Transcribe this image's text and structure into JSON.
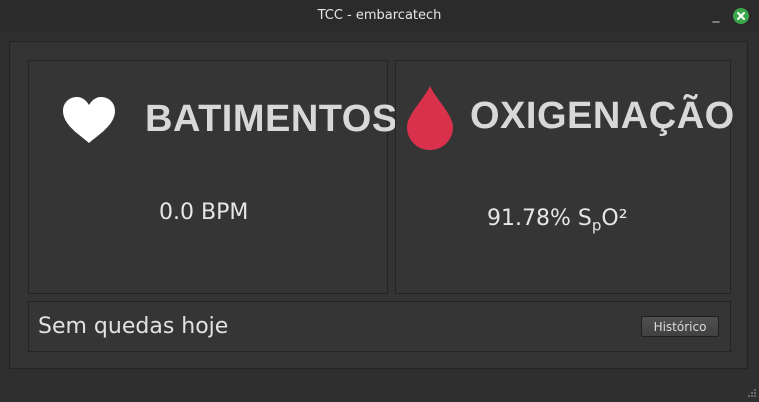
{
  "window": {
    "title": "TCC - embarcatech",
    "minimize_glyph": "_"
  },
  "heart": {
    "icon": "heart-icon",
    "heading": "BATIMENTOS",
    "value": "0.0 BPM"
  },
  "oxygen": {
    "icon": "blood-drop-icon",
    "heading": "OXIGENAÇÃO",
    "value_main": "91.78% S",
    "value_sub": "p",
    "value_end": "O²"
  },
  "status": {
    "text": "Sem quedas hoje",
    "button_label": "Histórico"
  },
  "colors": {
    "accent_drop": "#d9304c",
    "close_button": "#3aa84a"
  }
}
